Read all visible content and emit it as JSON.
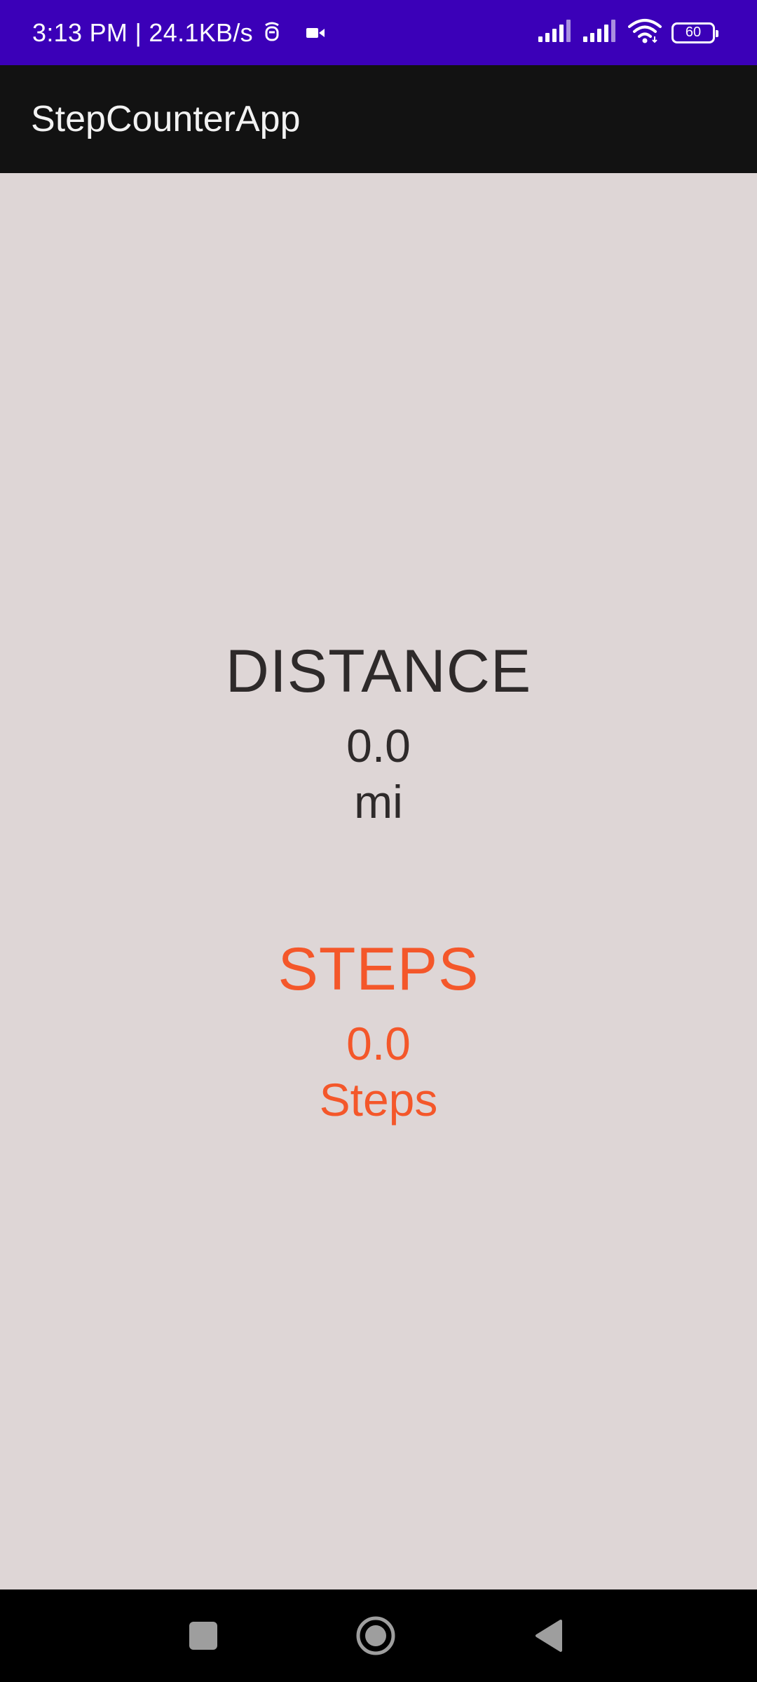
{
  "status_bar": {
    "time_speed": "3:13 PM | 24.1KB/s",
    "battery_level": "60",
    "icons": [
      "notification-icon",
      "video-camera-icon",
      "signal-icon",
      "signal-icon",
      "wifi-icon",
      "battery-icon"
    ],
    "background_color": "#3b00b8"
  },
  "app_bar": {
    "title": "StepCounterApp",
    "background_color": "#121212"
  },
  "main": {
    "background_color": "#ded6d6",
    "distance": {
      "label": "DISTANCE",
      "value": "0.0",
      "unit": "mi",
      "color": "#2e2a2a"
    },
    "steps": {
      "label": "STEPS",
      "value": "0.0",
      "unit": "Steps",
      "color": "#f4572a"
    }
  },
  "nav_bar": {
    "buttons": [
      "recents-button",
      "home-button",
      "back-button"
    ]
  }
}
